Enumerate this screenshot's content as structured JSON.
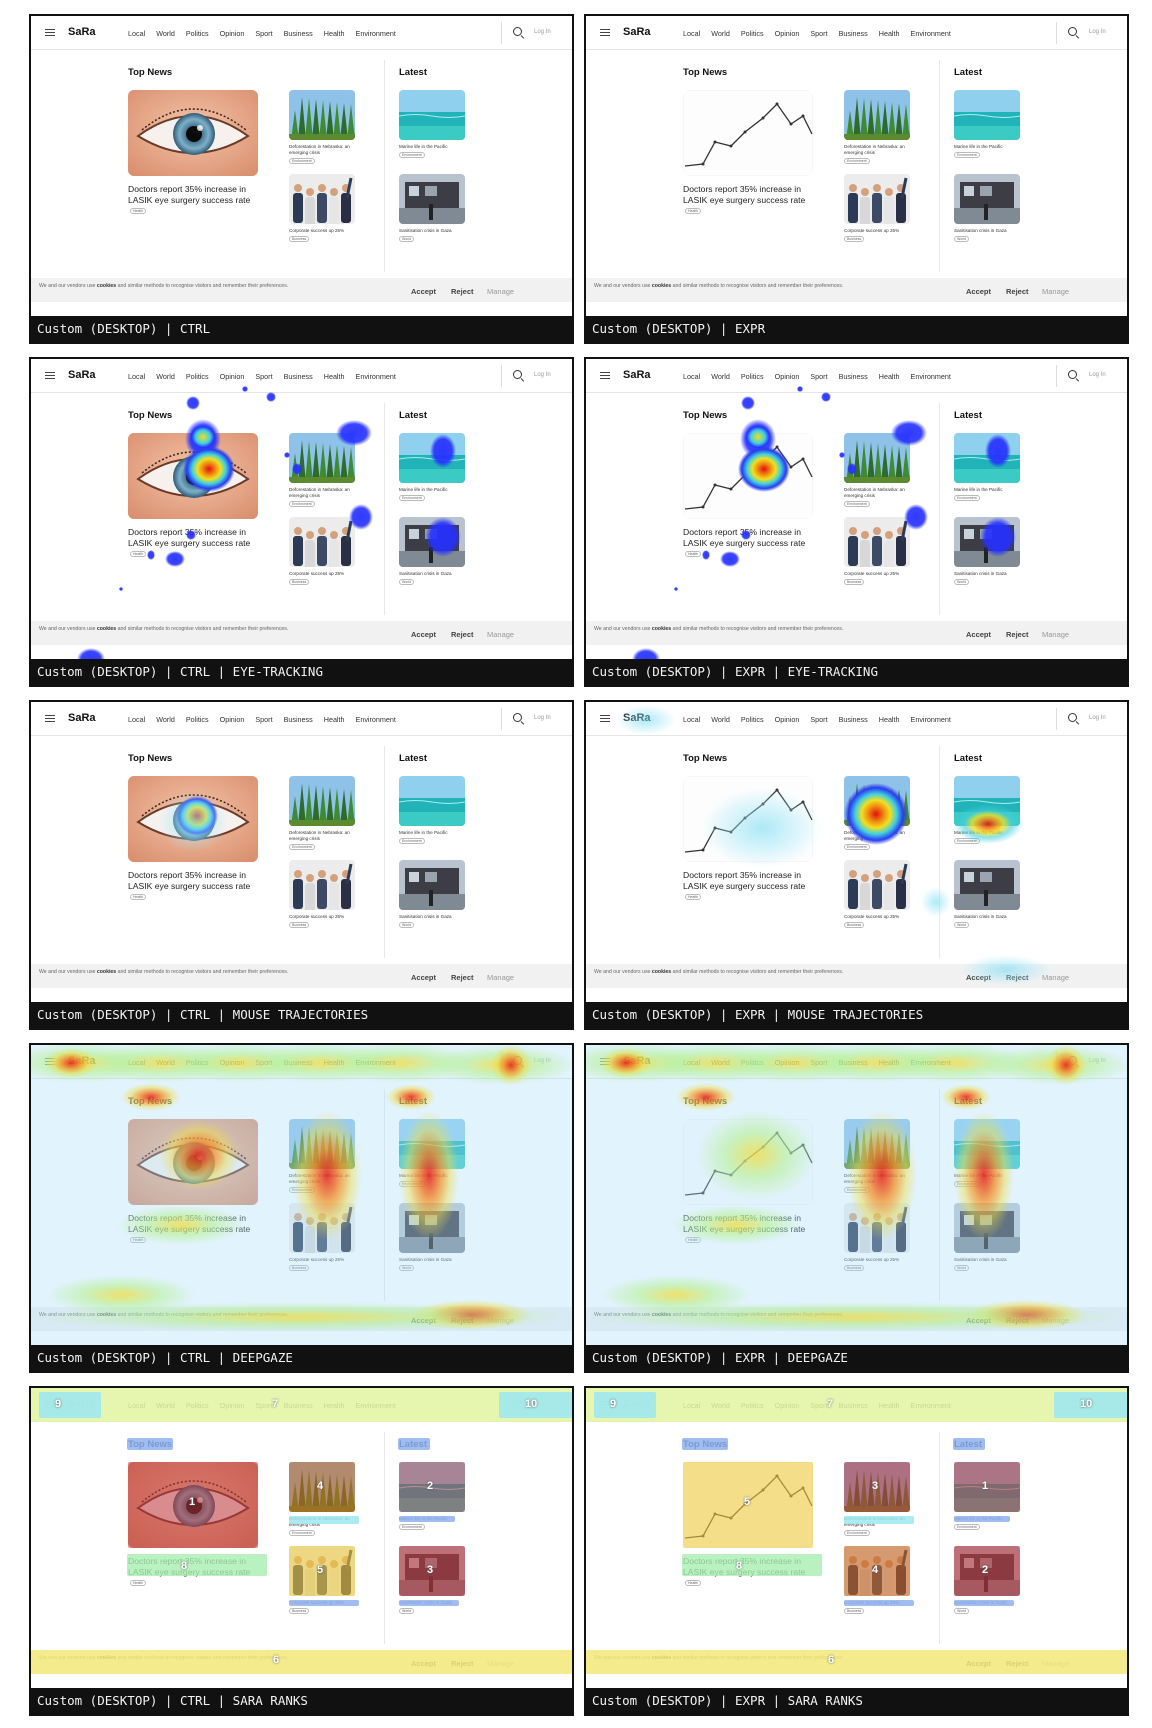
{
  "site": {
    "logo": "SaRa",
    "nav": [
      "Local",
      "World",
      "Politics",
      "Opinion",
      "Sport",
      "Business",
      "Health",
      "Environment"
    ],
    "login": "Log In",
    "top_news_heading": "Top News",
    "latest_heading": "Latest",
    "main_title": "Doctors report 35% increase in LASIK eye surgery success rate",
    "main_tag": "Health",
    "mid_items": [
      {
        "caption": "Deforestation in Nebraska: an emerging crisis",
        "tag": "Environment"
      },
      {
        "caption": "Corporate success up 25%",
        "tag": "Business"
      }
    ],
    "latest_items": [
      {
        "caption": "Marine life in the Pacific",
        "tag": "Environment"
      },
      {
        "caption": "Sanitisation crisis in Gaza",
        "tag": "World"
      }
    ],
    "cookie_text_pre": "We and our vendors use ",
    "cookie_text_bold": "cookies",
    "cookie_text_post": " and similar methods to recognise visitors and remember their preferences.",
    "accept": "Accept",
    "reject": "Reject",
    "manage": "Manage"
  },
  "panels": [
    {
      "caption": "Custom (DESKTOP) | CTRL",
      "variant": "ctrl",
      "overlay": "none"
    },
    {
      "caption": "Custom (DESKTOP) | EXPR",
      "variant": "expr",
      "overlay": "none"
    },
    {
      "caption": "Custom (DESKTOP) | CTRL | EYE-TRACKING",
      "variant": "ctrl",
      "overlay": "eye"
    },
    {
      "caption": "Custom (DESKTOP) | EXPR | EYE-TRACKING",
      "variant": "expr",
      "overlay": "eye"
    },
    {
      "caption": "Custom (DESKTOP) | CTRL | MOUSE TRAJECTORIES",
      "variant": "ctrl",
      "overlay": "mouse"
    },
    {
      "caption": "Custom (DESKTOP) | EXPR | MOUSE TRAJECTORIES",
      "variant": "expr",
      "overlay": "mouse"
    },
    {
      "caption": "Custom (DESKTOP) | CTRL | DEEPGAZE",
      "variant": "ctrl",
      "overlay": "deepgaze"
    },
    {
      "caption": "Custom (DESKTOP) | EXPR | DEEPGAZE",
      "variant": "expr",
      "overlay": "deepgaze"
    },
    {
      "caption": "Custom (DESKTOP) | CTRL | SARA RANKS",
      "variant": "ctrl",
      "overlay": "ranks",
      "ranks": {
        "main": "1",
        "thumb_a": "4",
        "thumb_b": "5",
        "latest_a": "2",
        "latest_b": "3",
        "title": "8",
        "cookie": "6",
        "nav": "7",
        "logo": "9",
        "search": "10"
      }
    },
    {
      "caption": "Custom (DESKTOP) | EXPR | SARA RANKS",
      "variant": "expr",
      "overlay": "ranks",
      "ranks": {
        "main": "5",
        "thumb_a": "3",
        "thumb_b": "4",
        "latest_a": "1",
        "latest_b": "2",
        "title": "8",
        "cookie": "6",
        "nav": "7",
        "logo": "9",
        "search": "10"
      }
    }
  ],
  "colors": {
    "rank_red": "#c0383e",
    "rank_orange": "#c8641e",
    "rank_yellow": "#f0c93e",
    "rank_cyan": "#9ee8ee",
    "rank_blue": "#8fb2f0",
    "rank_lime": "#e2f5a0",
    "eye_blob": "#2530ff"
  }
}
